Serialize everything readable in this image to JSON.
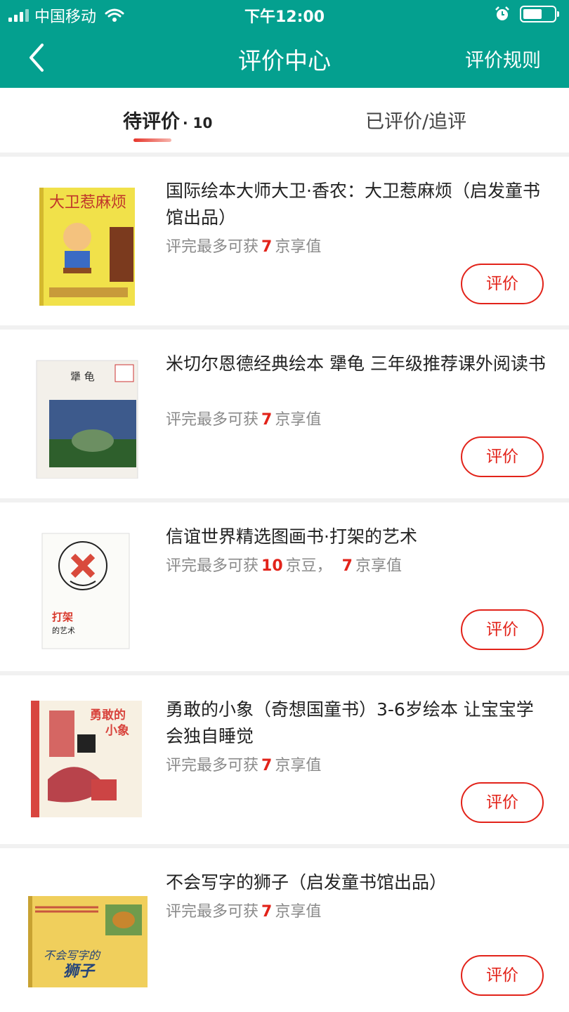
{
  "status_bar": {
    "carrier": "中国移动",
    "time": "下午12:00"
  },
  "header": {
    "title": "评价中心",
    "rules_label": "评价规则"
  },
  "tabs": [
    {
      "label": "待评价",
      "count": "· 10"
    },
    {
      "label": "已评价/追评"
    }
  ],
  "items": [
    {
      "title": "国际绘本大师大卫·香农：大卫惹麻烦（启发童书馆出品）",
      "reward_prefix": "评完最多可获",
      "reward_num": "7",
      "reward_unit": "京享值",
      "button": "评价",
      "cover_title": "大卫惹麻烦"
    },
    {
      "title": "米切尔恩德经典绘本 犟龟 三年级推荐课外阅读书",
      "reward_prefix": "评完最多可获",
      "reward_num": "7",
      "reward_unit": "京享值",
      "button": "评价",
      "cover_title": "犟 龟"
    },
    {
      "title": "信谊世界精选图画书·打架的艺术",
      "reward_prefix": "评完最多可获",
      "reward_num": "10",
      "reward_unit": "京豆，",
      "reward_num2": "7",
      "reward_unit2": "京享值",
      "button": "评价",
      "cover_title": "打架",
      "cover_subtitle": "的艺术"
    },
    {
      "title": "勇敢的小象（奇想国童书）3-6岁绘本 让宝宝学会独自睡觉",
      "reward_prefix": "评完最多可获",
      "reward_num": "7",
      "reward_unit": "京享值",
      "button": "评价",
      "cover_title": "勇敢的",
      "cover_subtitle": "小象"
    },
    {
      "title": "不会写字的狮子（启发童书馆出品）",
      "reward_prefix": "评完最多可获",
      "reward_num": "7",
      "reward_unit": "京享值",
      "button": "评价",
      "cover_title": "不会写字的",
      "cover_subtitle": "狮子"
    }
  ],
  "colors": {
    "header": "#04a08f",
    "accent": "#e2231a"
  }
}
